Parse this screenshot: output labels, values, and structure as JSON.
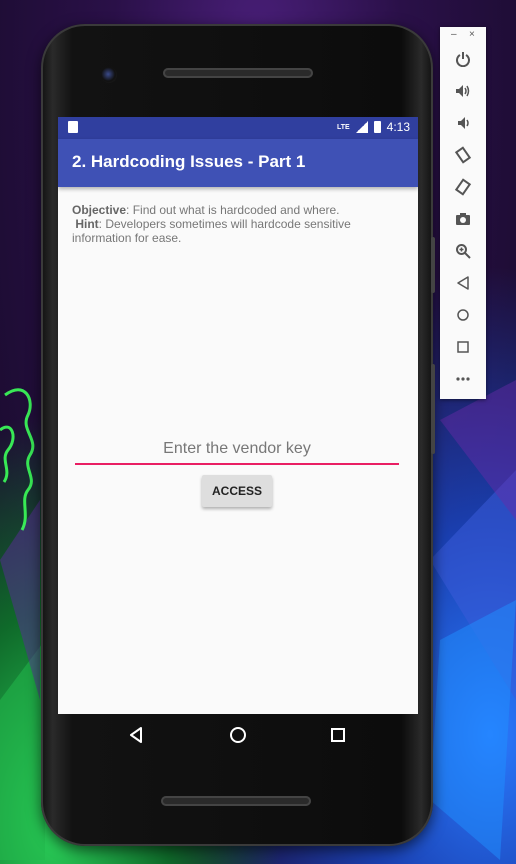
{
  "statusbar": {
    "network": "LTE",
    "time": "4:13"
  },
  "appbar": {
    "title": "2. Hardcoding Issues - Part 1"
  },
  "content": {
    "objective_label": "Objective",
    "objective_text": ": Find out what is hardcoded and where.",
    "hint_label": "Hint",
    "hint_text": ": Developers sometimes will hardcode sensitive information for ease.",
    "vendor_key_placeholder": "Enter the vendor key",
    "vendor_key_value": "",
    "access_button_label": "ACCESS"
  },
  "navbar": {
    "icons": [
      "back-icon",
      "home-icon",
      "recents-icon"
    ]
  },
  "emulator_toolbar": {
    "window_controls": {
      "minimize": "–",
      "close": "×"
    },
    "icons": [
      "power-icon",
      "volume-up-icon",
      "volume-down-icon",
      "rotate-left-icon",
      "rotate-right-icon",
      "camera-icon",
      "zoom-icon",
      "back-icon",
      "home-icon",
      "overview-icon",
      "more-icon"
    ]
  },
  "colors": {
    "statusbar": "#303f9f",
    "appbar": "#3f51b5",
    "input_underline": "#e91e63",
    "screen_bg": "#fafafa",
    "button_bg": "#dedede"
  }
}
